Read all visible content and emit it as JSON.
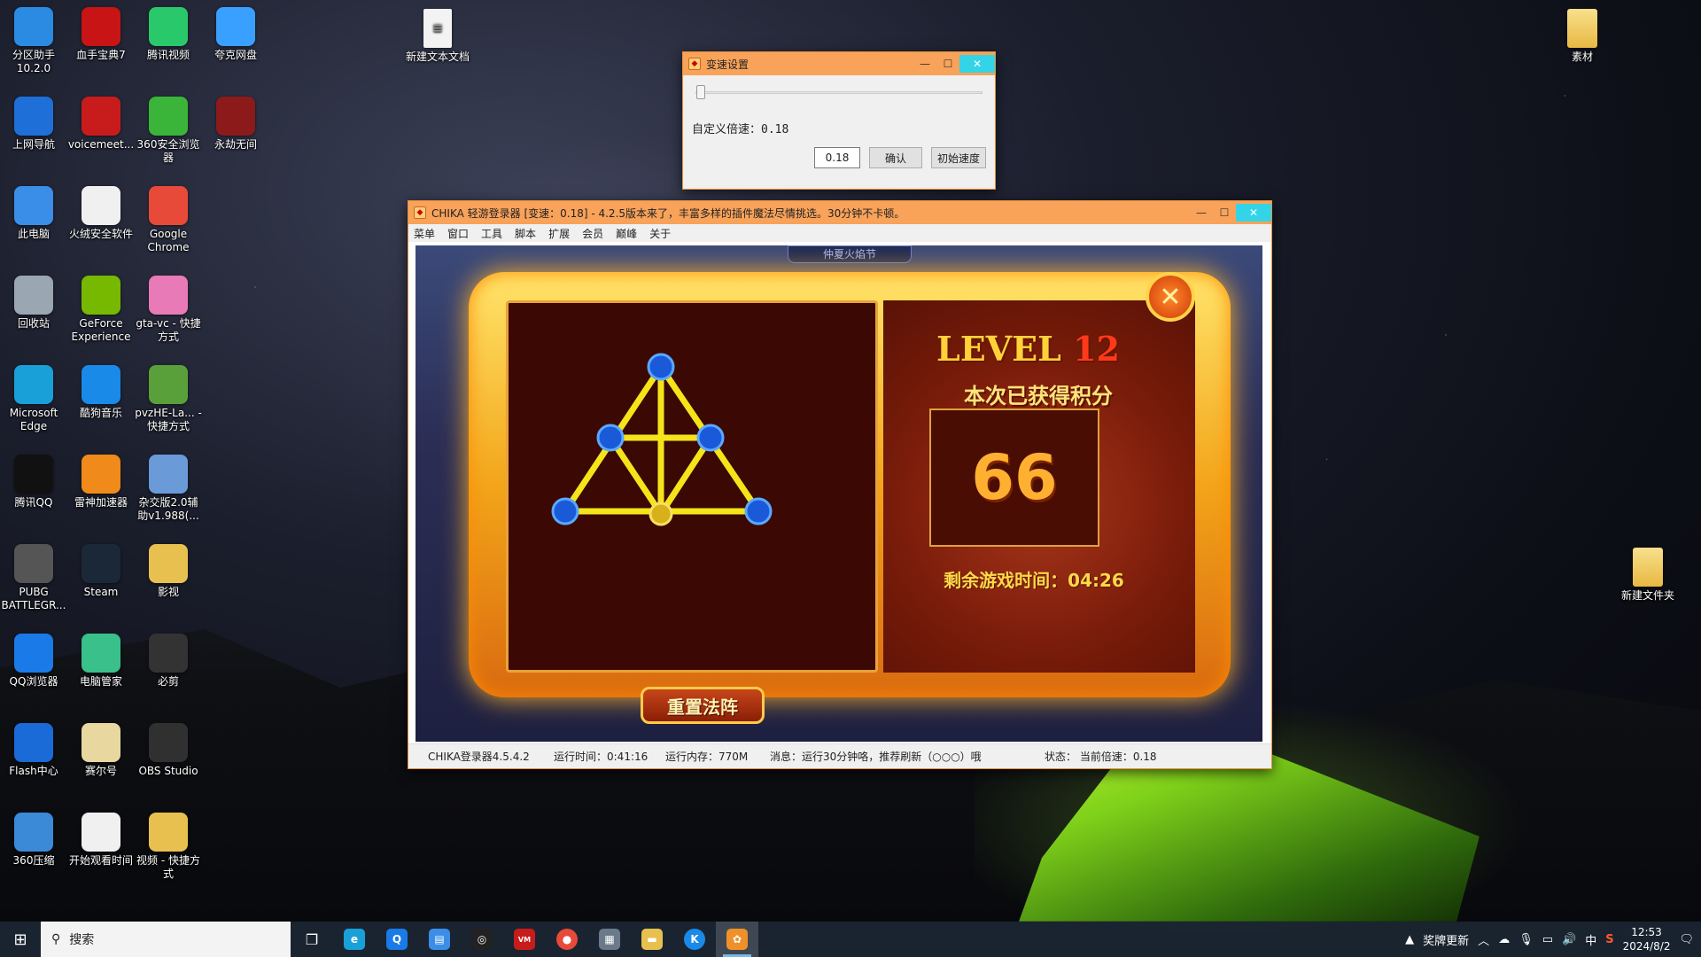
{
  "desktop_icons": [
    {
      "label": "分区助手\n10.2.0",
      "icon": "partition-icon",
      "color": "#2b8ae2"
    },
    {
      "label": "血手宝典7",
      "icon": "bloody-hand-icon",
      "color": "#c81414"
    },
    {
      "label": "腾讯视频",
      "icon": "tencent-video-icon",
      "color": "#29c86a"
    },
    {
      "label": "夸克网盘",
      "icon": "quark-cloud-icon",
      "color": "#3aa0ff"
    },
    {
      "label": "上网导航",
      "icon": "ie-icon",
      "color": "#1e6fd8"
    },
    {
      "label": "voicemeet...",
      "icon": "voicemeeter-icon",
      "color": "#c81c1c"
    },
    {
      "label": "360安全浏览器",
      "icon": "360-browser-icon",
      "color": "#3ab53a"
    },
    {
      "label": "永劫无间",
      "icon": "naraka-icon",
      "color": "#8c1a1a"
    },
    {
      "label": "此电脑",
      "icon": "computer-icon",
      "color": "#3a8ee8"
    },
    {
      "label": "火绒安全软件",
      "icon": "huorong-icon",
      "color": "#f0f0f0"
    },
    {
      "label": "Google Chrome",
      "icon": "chrome-icon",
      "color": "#e84a3a"
    },
    {
      "label": "回收站",
      "icon": "recycle-bin-icon",
      "color": "#9aa6b2"
    },
    {
      "label": "GeForce Experience",
      "icon": "geforce-icon",
      "color": "#76b900"
    },
    {
      "label": "gta-vc - 快捷方式",
      "icon": "gta-vc-icon",
      "color": "#e87ab8"
    },
    {
      "label": "Microsoft Edge",
      "icon": "edge-icon",
      "color": "#1aa0d8"
    },
    {
      "label": "酷狗音乐",
      "icon": "kugou-icon",
      "color": "#1a8ae8"
    },
    {
      "label": "pvzHE-La... - 快捷方式",
      "icon": "pvz-icon",
      "color": "#5aa03a"
    },
    {
      "label": "腾讯QQ",
      "icon": "qq-icon",
      "color": "#111111"
    },
    {
      "label": "雷神加速器",
      "icon": "leishen-icon",
      "color": "#f08a1a"
    },
    {
      "label": "杂交版2.0辅助v1.988(...",
      "icon": "pvz-helper-icon",
      "color": "#6a9ad8"
    },
    {
      "label": "PUBG BATTLEGR...",
      "icon": "pubg-icon",
      "color": "#555555"
    },
    {
      "label": "Steam",
      "icon": "steam-icon",
      "color": "#1b2838"
    },
    {
      "label": "影视",
      "icon": "folder-icon",
      "color": "#e8c050"
    },
    {
      "label": "QQ浏览器",
      "icon": "qq-browser-icon",
      "color": "#1a7ae8"
    },
    {
      "label": "电脑管家",
      "icon": "pc-manager-icon",
      "color": "#3ac08a"
    },
    {
      "label": "必剪",
      "icon": "bijian-icon",
      "color": "#333333"
    },
    {
      "label": "Flash中心",
      "icon": "flash-icon",
      "color": "#1a6ad8"
    },
    {
      "label": "赛尔号",
      "icon": "seer-icon",
      "color": "#e8d8a0"
    },
    {
      "label": "OBS Studio",
      "icon": "obs-icon",
      "color": "#303030"
    },
    {
      "label": "360压缩",
      "icon": "360-zip-icon",
      "color": "#3a8ad8"
    },
    {
      "label": "开始观看时间",
      "icon": "text-doc-icon",
      "color": "#f0f0f0"
    },
    {
      "label": "视频 - 快捷方式",
      "icon": "video-folder-icon",
      "color": "#e8c050"
    }
  ],
  "extra_icons": {
    "new_text_doc": "新建文本文档",
    "sucai": "素材",
    "new_folder": "新建文件夹"
  },
  "speed_window": {
    "title": "变速设置",
    "slider_fraction": 0.01,
    "custom_label": "自定义倍速：0.18",
    "value": "0.18",
    "confirm": "确认",
    "reset_speed": "初始速度"
  },
  "main_window": {
    "title": "CHIKA 轻游登录器 [变速：0.18] - 4.2.5版本来了，丰富多样的插件魔法尽情挑选。30分钟不卡顿。",
    "menu": [
      "菜单",
      "窗口",
      "工具",
      "脚本",
      "扩展",
      "会员",
      "巅峰",
      "关于"
    ],
    "game": {
      "level_word": "LEVEL",
      "level_num": "12",
      "score_title": "本次已获得积分",
      "score": "66",
      "remaining": "剩余游戏时间：04:26",
      "reset_button": "重置法阵",
      "close_glyph": "✕",
      "top_banner": "仲夏火焰节"
    },
    "status": {
      "version": "CHIKA登录器4.5.4.2",
      "runtime": "运行时间：0:41:16",
      "memory": "运行内存：770M",
      "message": "消息：运行30分钟咯，推荐刷新（○○○）哦",
      "state": "状态：  当前倍速：0.18"
    }
  },
  "taskbar": {
    "search_placeholder": "搜索",
    "tray_label": "奖牌更新",
    "ime": "中",
    "time": "12:53",
    "date": "2024/8/2"
  }
}
